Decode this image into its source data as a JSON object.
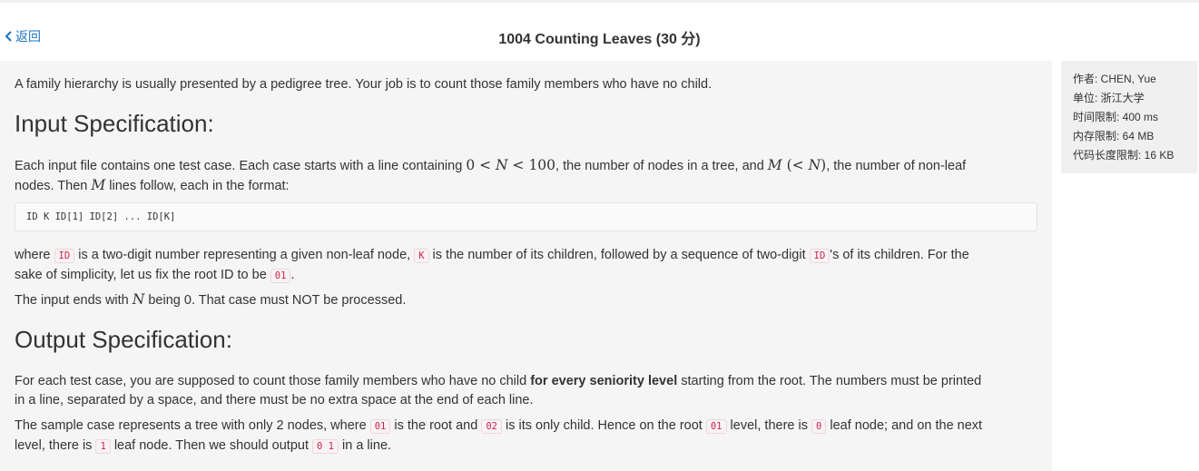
{
  "header": {
    "back_label": "返回",
    "title": "1004 Counting Leaves (30 分)"
  },
  "problem": {
    "intro": "A family hierarchy is usually presented by a pedigree tree. Your job is to count those family members who have no child.",
    "input_heading": "Input Specification:",
    "input_p1": {
      "t1": "Each input file contains one test case. Each case starts with a line containing ",
      "m1_zero": "0",
      "m1_lt1": " < ",
      "m1_N": "N",
      "m1_lt2": " < ",
      "m1_100": "100",
      "t2": ", the number of nodes in a tree, and ",
      "m2_M": "M",
      "m2_open": " (<",
      "m2_N": " N",
      "m2_close": ")",
      "t3": ", the number of non-leaf",
      "t4": "nodes. Then ",
      "m3_M": "M",
      "t5": " lines follow, each in the format:"
    },
    "format_code": "ID K ID[1] ID[2] ... ID[K]",
    "input_p2": {
      "t1": "where ",
      "c1": "ID",
      "t2": " is a two-digit number representing a given non-leaf node, ",
      "c2": "K",
      "t3": " is the number of its children, followed by a sequence of two-digit ",
      "c3": "ID",
      "t4": "'s of its children. For the",
      "t5": "sake of simplicity, let us fix the root ID to be ",
      "c4": "01",
      "t6": "."
    },
    "input_p3": {
      "t1": "The input ends with ",
      "m_N": "N",
      "t2": " being 0. That case must NOT be processed."
    },
    "output_heading": "Output Specification:",
    "output_p1": {
      "t1": "For each test case, you are supposed to count those family members who have no child ",
      "b1": "for every seniority level",
      "t2": " starting from the root. The numbers must be printed",
      "t3": "in a line, separated by a space, and there must be no extra space at the end of each line."
    },
    "output_p2": {
      "t1": "The sample case represents a tree with only 2 nodes, where ",
      "c1": "01",
      "t2": " is the root and ",
      "c2": "02",
      "t3": " is its only child. Hence on the root ",
      "c3": "01",
      "t4": " level, there is ",
      "c4": "0",
      "t5": " leaf node; and on the next",
      "t6": "level, there is ",
      "c5": "1",
      "t7": " leaf node. Then we should output ",
      "c6": "0 1",
      "t8": " in a line."
    }
  },
  "sidebar": {
    "author": "作者: CHEN, Yue",
    "unit": "单位: 浙江大学",
    "time_limit": "时间限制: 400 ms",
    "memory_limit": "内存限制: 64 MB",
    "code_limit": "代码长度限制: 16 KB"
  }
}
